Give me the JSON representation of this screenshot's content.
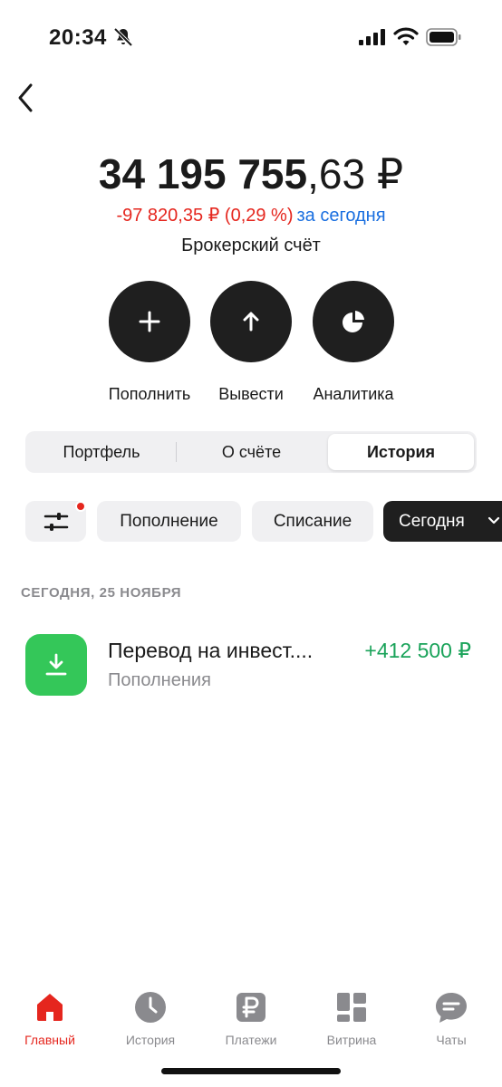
{
  "status": {
    "time": "20:34"
  },
  "balance": {
    "integer": "34 195 755",
    "fraction": ",63 ₽",
    "change_amount": "-97 820,35 ₽ (0,29 %)",
    "change_period": "за сегодня",
    "account_name": "Брокерский счёт"
  },
  "actions": [
    {
      "label": "Пополнить",
      "icon": "plus-icon"
    },
    {
      "label": "Вывести",
      "icon": "arrow-up-icon"
    },
    {
      "label": "Аналитика",
      "icon": "pie-chart-icon"
    }
  ],
  "segments": {
    "items": [
      "Портфель",
      "О счёте",
      "История"
    ],
    "selected": "История"
  },
  "filters": {
    "icon": "sliders-icon",
    "has_active_dot": true,
    "chips": [
      "Пополнение",
      "Списание",
      "Сегодня"
    ],
    "selected": "Сегодня"
  },
  "history": {
    "section_header": "СЕГОДНЯ, 25 НОЯБРЯ",
    "transactions": [
      {
        "title": "Перевод на инвест....",
        "category": "Пополнения",
        "amount": "+412 500 ₽",
        "icon": "download-icon"
      }
    ]
  },
  "tabbar": {
    "items": [
      {
        "label": "Главный",
        "icon": "home-icon",
        "active": true
      },
      {
        "label": "История",
        "icon": "clock-icon",
        "active": false
      },
      {
        "label": "Платежи",
        "icon": "ruble-icon",
        "active": false
      },
      {
        "label": "Витрина",
        "icon": "grid-icon",
        "active": false
      },
      {
        "label": "Чаты",
        "icon": "chat-icon",
        "active": false
      }
    ]
  },
  "colors": {
    "accent_red": "#e5261e",
    "positive_green": "#1aa35a",
    "link_blue": "#1a6fe0",
    "dark_button": "#1f1f1f",
    "icon_green": "#34c759"
  }
}
